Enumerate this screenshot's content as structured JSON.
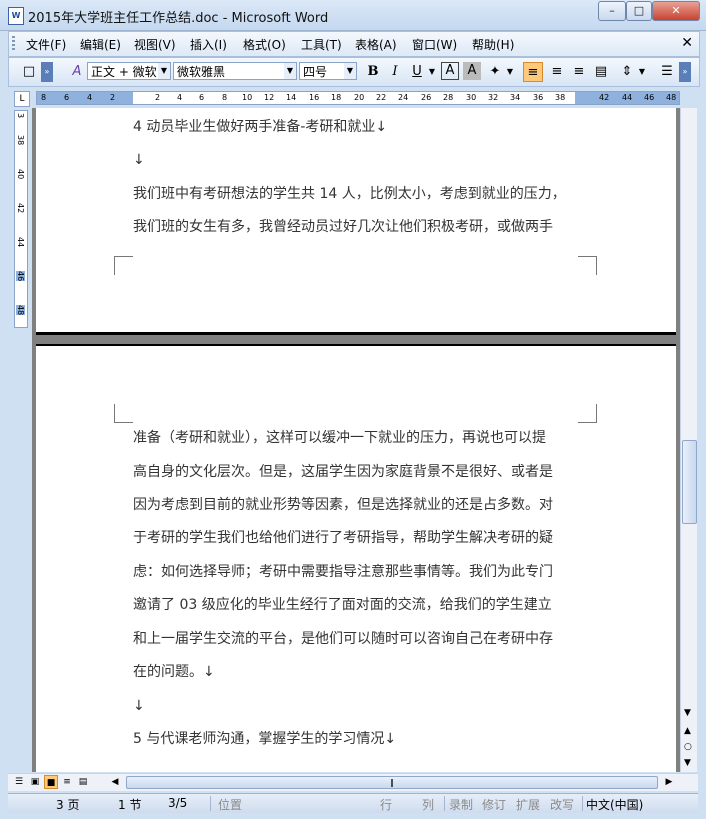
{
  "window": {
    "title": "2015年大学班主任工作总结.doc - Microsoft Word",
    "app_icon": "W",
    "controls": [
      "–",
      "□",
      "✕"
    ]
  },
  "menu": {
    "items": [
      "文件(F)",
      "编辑(E)",
      "视图(V)",
      "插入(I)",
      "格式(O)",
      "工具(T)",
      "表格(A)",
      "窗口(W)",
      "帮助(H)"
    ],
    "close": "✕"
  },
  "toolbar": {
    "style_value": "正文 + 微软",
    "font_value": "微软雅黑",
    "size_value": "四号",
    "bold": "B",
    "italic": "I",
    "underline": "U",
    "font_color": "A",
    "char_shading": "A"
  },
  "ruler": {
    "corner": "L",
    "h_ticks": [
      "8",
      "6",
      "4",
      "2",
      "2",
      "4",
      "6",
      "8",
      "10",
      "12",
      "14",
      "16",
      "18",
      "20",
      "22",
      "24",
      "26",
      "28",
      "30",
      "32",
      "34",
      "36",
      "38",
      "42",
      "44",
      "46",
      "48"
    ],
    "v_ticks": [
      "3",
      "38",
      "40",
      "42",
      "44",
      "46",
      "48"
    ]
  },
  "document": {
    "page1": [
      "4 动员毕业生做好两手准备-考研和就业↓",
      "↓",
      "我们班中有考研想法的学生共 14 人，比例太小，考虑到就业的压力，",
      "我们班的女生有多，我曾经动员过好几次让他们积极考研，或做两手"
    ],
    "page2": [
      "准备（考研和就业），这样可以缓冲一下就业的压力，再说也可以提",
      "高自身的文化层次。但是，这届学生因为家庭背景不是很好、或者是",
      "因为考虑到目前的就业形势等因素，但是选择就业的还是占多数。对",
      "于考研的学生我们也给他们进行了考研指导，帮助学生解决考研的疑",
      "虑：如何选择导师；考研中需要指导注意那些事情等。我们为此专门",
      "邀请了 03 级应化的毕业生经行了面对面的交流，给我们的学生建立",
      "和上一届学生交流的平台，是他们可以随时可以咨询自己在考研中存",
      "在的问题。↓",
      "↓",
      "5 与代课老师沟通，掌握学生的学习情况↓"
    ]
  },
  "statusbar": {
    "page": "3 页",
    "section": "1 节",
    "page_of": "3/5",
    "position": "位置",
    "line": "行",
    "column": "列",
    "rec": "录制",
    "trk": "修订",
    "ext": "扩展",
    "ovr": "改写",
    "language": "中文(中国)"
  },
  "colors": {
    "accent": "#ffc97a",
    "chrome": "#cfe0f3"
  }
}
